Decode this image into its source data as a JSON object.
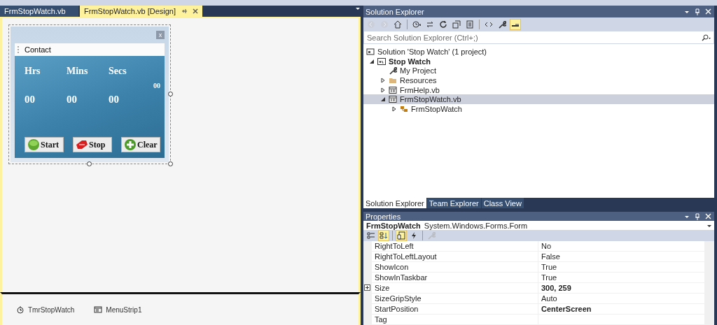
{
  "document_tabs": [
    {
      "label": "FrmStopWatch.vb",
      "selected": false
    },
    {
      "label": "FrmStopWatch.vb [Design]",
      "selected": true
    }
  ],
  "designer": {
    "form": {
      "close_glyph": "x",
      "menu": [
        "Contact"
      ],
      "headers": [
        "Hrs",
        "Mins",
        "Secs"
      ],
      "readouts": [
        "00",
        "00",
        "00"
      ],
      "small_readout": "00",
      "buttons": [
        {
          "label": "Start",
          "kind": "start"
        },
        {
          "label": "Stop",
          "kind": "stop"
        },
        {
          "label": "Clear",
          "kind": "clear"
        }
      ]
    },
    "tray": [
      {
        "label": "TmrStopWatch",
        "kind": "timer"
      },
      {
        "label": "MenuStrip1",
        "kind": "menu"
      }
    ]
  },
  "solution_explorer": {
    "title": "Solution Explorer",
    "toolbar": [
      {
        "kind": "back",
        "disabled": true
      },
      {
        "kind": "forward",
        "disabled": true
      },
      {
        "kind": "home",
        "disabled": false
      },
      {
        "kind": "filter",
        "disabled": false
      },
      {
        "kind": "sync",
        "disabled": false
      },
      {
        "kind": "refresh",
        "disabled": false
      },
      {
        "kind": "collapse",
        "disabled": false
      },
      {
        "kind": "files",
        "disabled": false
      },
      {
        "kind": "code",
        "disabled": false
      },
      {
        "kind": "properties",
        "disabled": false
      },
      {
        "kind": "preview",
        "disabled": false,
        "selected": true
      }
    ],
    "search": {
      "placeholder": "Search Solution Explorer (Ctrl+;)"
    },
    "tree": [
      {
        "label": "Solution 'Stop Watch' (1 project)",
        "kind": "solution",
        "selected": false,
        "children": [
          {
            "label": "Stop Watch",
            "kind": "project",
            "expanded": true,
            "selected": false,
            "children": [
              {
                "label": "My Project",
                "kind": "settings",
                "selected": false
              },
              {
                "label": "Resources",
                "kind": "folder",
                "expanded": false,
                "selected": false
              },
              {
                "label": "FrmHelp.vb",
                "kind": "form",
                "expanded": false,
                "selected": false
              },
              {
                "label": "FrmStopWatch.vb",
                "kind": "form",
                "expanded": true,
                "selected": true,
                "children": [
                  {
                    "label": "FrmStopWatch",
                    "kind": "class",
                    "expanded": false,
                    "selected": false
                  }
                ]
              }
            ]
          }
        ]
      }
    ],
    "tabs": [
      {
        "label": "Solution Explorer",
        "selected": true
      },
      {
        "label": "Team Explorer",
        "selected": false
      },
      {
        "label": "Class View",
        "selected": false
      }
    ]
  },
  "properties": {
    "title": "Properties",
    "object_name": "FrmStopWatch",
    "object_type": "System.Windows.Forms.Form",
    "toolbar": [
      {
        "kind": "categorized",
        "selected": false,
        "disabled": false
      },
      {
        "kind": "alphabetical",
        "selected": true,
        "disabled": false
      },
      {
        "kind": "props",
        "selected": true,
        "disabled": false
      },
      {
        "kind": "events",
        "selected": false,
        "disabled": false
      },
      {
        "kind": "pages",
        "selected": false,
        "disabled": true
      }
    ],
    "rows": [
      {
        "name": "RightToLeft",
        "value": "No",
        "modified": false
      },
      {
        "name": "RightToLeftLayout",
        "value": "False",
        "modified": false
      },
      {
        "name": "ShowIcon",
        "value": "True",
        "modified": false
      },
      {
        "name": "ShowInTaskbar",
        "value": "True",
        "modified": false
      },
      {
        "name": "Size",
        "value": "300, 259",
        "modified": true,
        "expandable": true
      },
      {
        "name": "SizeGripStyle",
        "value": "Auto",
        "modified": false
      },
      {
        "name": "StartPosition",
        "value": "CenterScreen",
        "modified": true
      },
      {
        "name": "Tag",
        "value": ""
      }
    ]
  }
}
